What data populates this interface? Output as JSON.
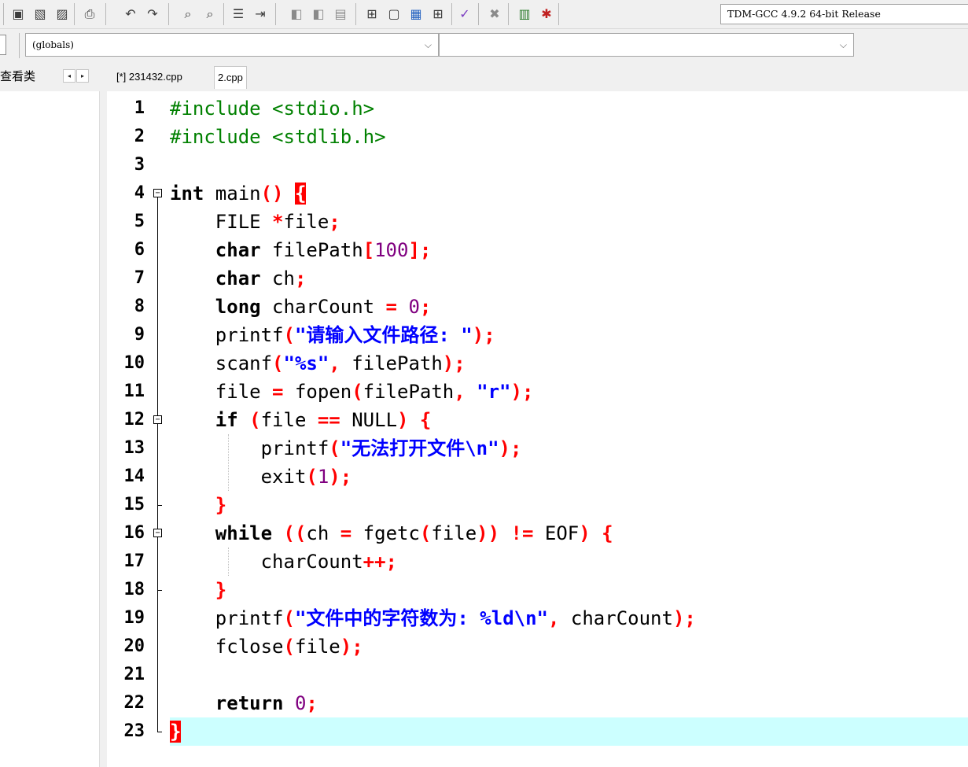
{
  "toolbar": {
    "compiler": "TDM-GCC 4.9.2 64-bit Release",
    "icons": [
      "save-all-icon",
      "close-file-icon",
      "close-all-icon",
      "print-icon",
      "undo-icon",
      "redo-icon",
      "find-icon",
      "replace-icon",
      "indent-icon",
      "unindent-icon",
      "bookmark-icon",
      "goto-bookmark-icon",
      "comment-icon",
      "layout-icon",
      "window-icon",
      "project-icon",
      "grid-icon",
      "check-icon",
      "delete-icon",
      "chart-icon",
      "debug-icon"
    ]
  },
  "scope_bar": {
    "globals_value": "(globals)",
    "members_value": ""
  },
  "panel": {
    "tab_label": "查看类",
    "prev": "◂",
    "next": "▸"
  },
  "tabs": [
    {
      "label": "[*] 231432.cpp",
      "active": false
    },
    {
      "label": "2.cpp",
      "active": true
    }
  ],
  "editor": {
    "current_line": 23,
    "lines": [
      {
        "n": "1",
        "tokens": [
          [
            "pp",
            "#include <stdio.h>"
          ]
        ]
      },
      {
        "n": "2",
        "tokens": [
          [
            "pp",
            "#include <stdlib.h>"
          ]
        ]
      },
      {
        "n": "3",
        "tokens": []
      },
      {
        "n": "4",
        "tokens": [
          [
            "kw",
            "int"
          ],
          [
            "id",
            " main"
          ],
          [
            "sym",
            "()"
          ],
          [
            "id",
            " "
          ],
          [
            "bm",
            "{"
          ]
        ]
      },
      {
        "n": "5",
        "tokens": [
          [
            "id",
            "    FILE "
          ],
          [
            "sym",
            "*"
          ],
          [
            "id",
            "file"
          ],
          [
            "sym",
            ";"
          ]
        ]
      },
      {
        "n": "6",
        "tokens": [
          [
            "id",
            "    "
          ],
          [
            "kw",
            "char"
          ],
          [
            "id",
            " filePath"
          ],
          [
            "sym",
            "["
          ],
          [
            "num",
            "100"
          ],
          [
            "sym",
            "];"
          ]
        ]
      },
      {
        "n": "7",
        "tokens": [
          [
            "id",
            "    "
          ],
          [
            "kw",
            "char"
          ],
          [
            "id",
            " ch"
          ],
          [
            "sym",
            ";"
          ]
        ]
      },
      {
        "n": "8",
        "tokens": [
          [
            "id",
            "    "
          ],
          [
            "kw",
            "long"
          ],
          [
            "id",
            " charCount "
          ],
          [
            "sym",
            "="
          ],
          [
            "id",
            " "
          ],
          [
            "num",
            "0"
          ],
          [
            "sym",
            ";"
          ]
        ]
      },
      {
        "n": "9",
        "tokens": [
          [
            "id",
            "    printf"
          ],
          [
            "sym",
            "("
          ],
          [
            "str",
            "\"请输入文件路径: \""
          ],
          [
            "sym",
            ");"
          ]
        ]
      },
      {
        "n": "10",
        "tokens": [
          [
            "id",
            "    scanf"
          ],
          [
            "sym",
            "("
          ],
          [
            "str",
            "\"%s\""
          ],
          [
            "sym",
            ","
          ],
          [
            "id",
            " filePath"
          ],
          [
            "sym",
            ");"
          ]
        ]
      },
      {
        "n": "11",
        "tokens": [
          [
            "id",
            "    file "
          ],
          [
            "sym",
            "="
          ],
          [
            "id",
            " fopen"
          ],
          [
            "sym",
            "("
          ],
          [
            "id",
            "filePath"
          ],
          [
            "sym",
            ","
          ],
          [
            "id",
            " "
          ],
          [
            "str",
            "\"r\""
          ],
          [
            "sym",
            ");"
          ]
        ]
      },
      {
        "n": "12",
        "tokens": [
          [
            "id",
            "    "
          ],
          [
            "kw",
            "if"
          ],
          [
            "id",
            " "
          ],
          [
            "sym",
            "("
          ],
          [
            "id",
            "file "
          ],
          [
            "sym",
            "=="
          ],
          [
            "id",
            " NULL"
          ],
          [
            "sym",
            ")"
          ],
          [
            "id",
            " "
          ],
          [
            "sym",
            "{"
          ]
        ]
      },
      {
        "n": "13",
        "tokens": [
          [
            "id",
            "        printf"
          ],
          [
            "sym",
            "("
          ],
          [
            "str",
            "\"无法打开文件\\n\""
          ],
          [
            "sym",
            ");"
          ]
        ]
      },
      {
        "n": "14",
        "tokens": [
          [
            "id",
            "        exit"
          ],
          [
            "sym",
            "("
          ],
          [
            "num",
            "1"
          ],
          [
            "sym",
            ");"
          ]
        ]
      },
      {
        "n": "15",
        "tokens": [
          [
            "id",
            "    "
          ],
          [
            "sym",
            "}"
          ]
        ]
      },
      {
        "n": "16",
        "tokens": [
          [
            "id",
            "    "
          ],
          [
            "kw",
            "while"
          ],
          [
            "id",
            " "
          ],
          [
            "sym",
            "(("
          ],
          [
            "id",
            "ch "
          ],
          [
            "sym",
            "="
          ],
          [
            "id",
            " fgetc"
          ],
          [
            "sym",
            "("
          ],
          [
            "id",
            "file"
          ],
          [
            "sym",
            "))"
          ],
          [
            "id",
            " "
          ],
          [
            "sym",
            "!="
          ],
          [
            "id",
            " EOF"
          ],
          [
            "sym",
            ")"
          ],
          [
            "id",
            " "
          ],
          [
            "sym",
            "{"
          ]
        ]
      },
      {
        "n": "17",
        "tokens": [
          [
            "id",
            "        charCount"
          ],
          [
            "sym",
            "++;"
          ]
        ]
      },
      {
        "n": "18",
        "tokens": [
          [
            "id",
            "    "
          ],
          [
            "sym",
            "}"
          ]
        ]
      },
      {
        "n": "19",
        "tokens": [
          [
            "id",
            "    printf"
          ],
          [
            "sym",
            "("
          ],
          [
            "str",
            "\"文件中的字符数为: %ld\\n\""
          ],
          [
            "sym",
            ","
          ],
          [
            "id",
            " charCount"
          ],
          [
            "sym",
            ");"
          ]
        ]
      },
      {
        "n": "20",
        "tokens": [
          [
            "id",
            "    fclose"
          ],
          [
            "sym",
            "("
          ],
          [
            "id",
            "file"
          ],
          [
            "sym",
            ");"
          ]
        ]
      },
      {
        "n": "21",
        "tokens": []
      },
      {
        "n": "22",
        "tokens": [
          [
            "id",
            "    "
          ],
          [
            "kw",
            "return"
          ],
          [
            "id",
            " "
          ],
          [
            "num",
            "0"
          ],
          [
            "sym",
            ";"
          ]
        ]
      },
      {
        "n": "23",
        "tokens": [
          [
            "bm",
            "}"
          ]
        ]
      }
    ]
  }
}
